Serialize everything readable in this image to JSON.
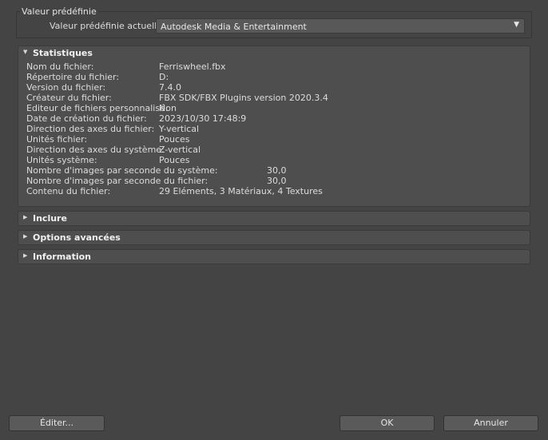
{
  "preset": {
    "group_title": "Valeur prédéfinie",
    "current_label": "Valeur prédéfinie actuelle:",
    "current_value": "Autodesk Media & Entertainment"
  },
  "statistics": {
    "title": "Statistiques",
    "rows": [
      {
        "label": "Nom du fichier:",
        "value": "Ferriswheel.fbx"
      },
      {
        "label": "Répertoire du fichier:",
        "value": "D:"
      },
      {
        "label": "Version du fichier:",
        "value": "7.4.0"
      },
      {
        "label": "Créateur du fichier:",
        "value": "FBX SDK/FBX Plugins version 2020.3.4"
      },
      {
        "label": "Editeur de fichiers personnalisé:",
        "value": "Non"
      },
      {
        "label": "Date de création du fichier:",
        "value": "2023/10/30  17:48:9"
      },
      {
        "label": "Direction des axes du fichier:",
        "value": "Y-vertical"
      },
      {
        "label": "Unités fichier:",
        "value": "Pouces"
      },
      {
        "label": "Direction des axes du système:",
        "value": "Z-vertical"
      },
      {
        "label": "Unités système:",
        "value": "Pouces"
      },
      {
        "label": "Nombre d'images par seconde du système:",
        "value": "30,0"
      },
      {
        "label": "Nombre d'images par seconde du fichier:",
        "value": "30,0"
      },
      {
        "label": "Contenu du fichier:",
        "value": "29 Eléments,   3 Matériaux,   4 Textures"
      }
    ]
  },
  "rollouts": {
    "include": "Inclure",
    "advanced": "Options avancées",
    "information": "Information"
  },
  "buttons": {
    "edit": "Éditer...",
    "ok": "OK",
    "cancel": "Annuler"
  }
}
